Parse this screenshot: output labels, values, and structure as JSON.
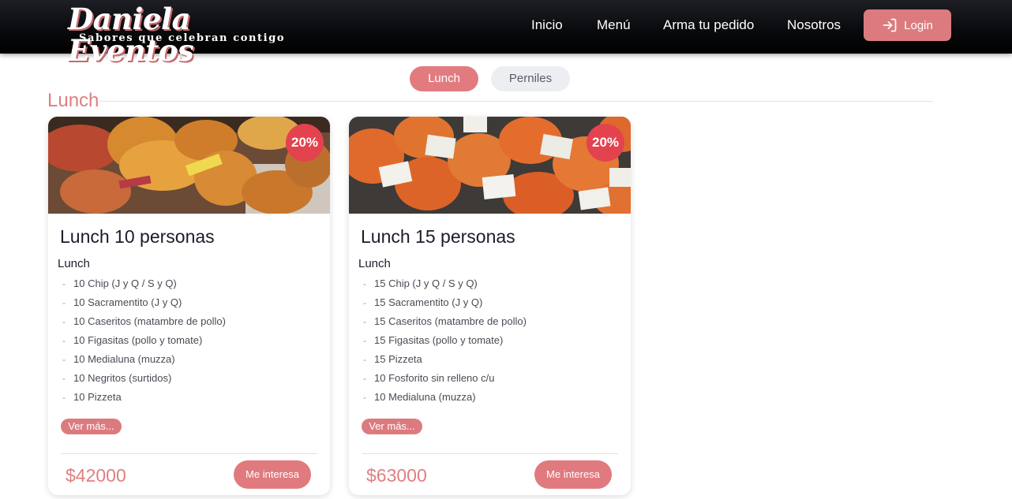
{
  "brand": {
    "name": "Daniela Eventos",
    "tagline": "Sabores que celebran contigo"
  },
  "nav": {
    "items": [
      "Inicio",
      "Menú",
      "Arma tu pedido",
      "Nosotros"
    ],
    "login_label": "Login"
  },
  "tabs": [
    {
      "label": "Lunch",
      "active": true
    },
    {
      "label": "Perniles",
      "active": false
    }
  ],
  "section": {
    "title": "Lunch"
  },
  "cards": [
    {
      "title": "Lunch 10 personas",
      "discount": "20%",
      "subtitle": "Lunch",
      "items": [
        "10 Chip (J y Q / S y Q)",
        "10 Sacramentito (J y Q)",
        "10 Caseritos (matambre de pollo)",
        "10 Figasitas (pollo y tomate)",
        "10 Medialuna (muzza)",
        "10 Negritos (surtidos)",
        "10 Pizzeta"
      ],
      "more_label": "Ver más...",
      "price": "$42000",
      "interest_label": "Me interesa"
    },
    {
      "title": "Lunch 15 personas",
      "discount": "20%",
      "subtitle": "Lunch",
      "items": [
        "15 Chip (J y Q / S y Q)",
        "15 Sacramentito (J y Q)",
        "15 Caseritos (matambre de pollo)",
        "15 Figasitas (pollo y tomate)",
        "15 Pizzeta",
        "10 Fosforito sin relleno c/u",
        "10 Medialuna (muzza)"
      ],
      "more_label": "Ver más...",
      "price": "$63000",
      "interest_label": "Me interesa"
    }
  ],
  "colors": {
    "accent": "#e07e82",
    "discount_badge": "#e3434f",
    "header_bg": "#000000"
  }
}
